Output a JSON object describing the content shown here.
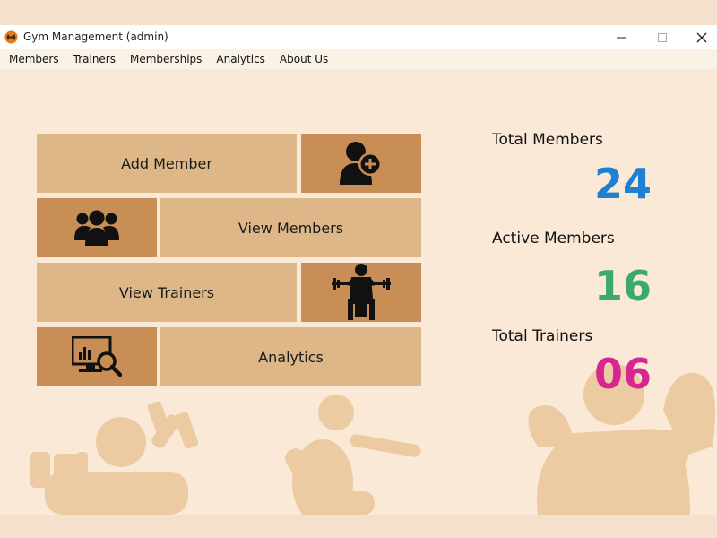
{
  "window": {
    "title": "Gym Management (admin)"
  },
  "menu": {
    "items": [
      {
        "label": "Members"
      },
      {
        "label": "Trainers"
      },
      {
        "label": "Memberships"
      },
      {
        "label": "Analytics"
      },
      {
        "label": "About Us"
      }
    ]
  },
  "tiles": {
    "add_member": "Add Member",
    "view_members": "View Members",
    "view_trainers": "View Trainers",
    "analytics": "Analytics"
  },
  "icons": {
    "add_member": "add-user-icon",
    "view_members": "group-icon",
    "view_trainers": "weightlifter-icon",
    "analytics": "analytics-search-icon"
  },
  "stats": {
    "total_members": {
      "label": "Total Members",
      "value": "24",
      "color": "#1f7fd0"
    },
    "active_members": {
      "label": "Active Members",
      "value": "16",
      "color": "#3aaa6e"
    },
    "total_trainers": {
      "label": "Total Trainers",
      "value": "06",
      "color": "#d6268f"
    }
  },
  "colors": {
    "background": "#fae9d6",
    "tile_light": "#ddb788",
    "tile_dark": "#c98e55",
    "silhouette": "#eccba3"
  }
}
